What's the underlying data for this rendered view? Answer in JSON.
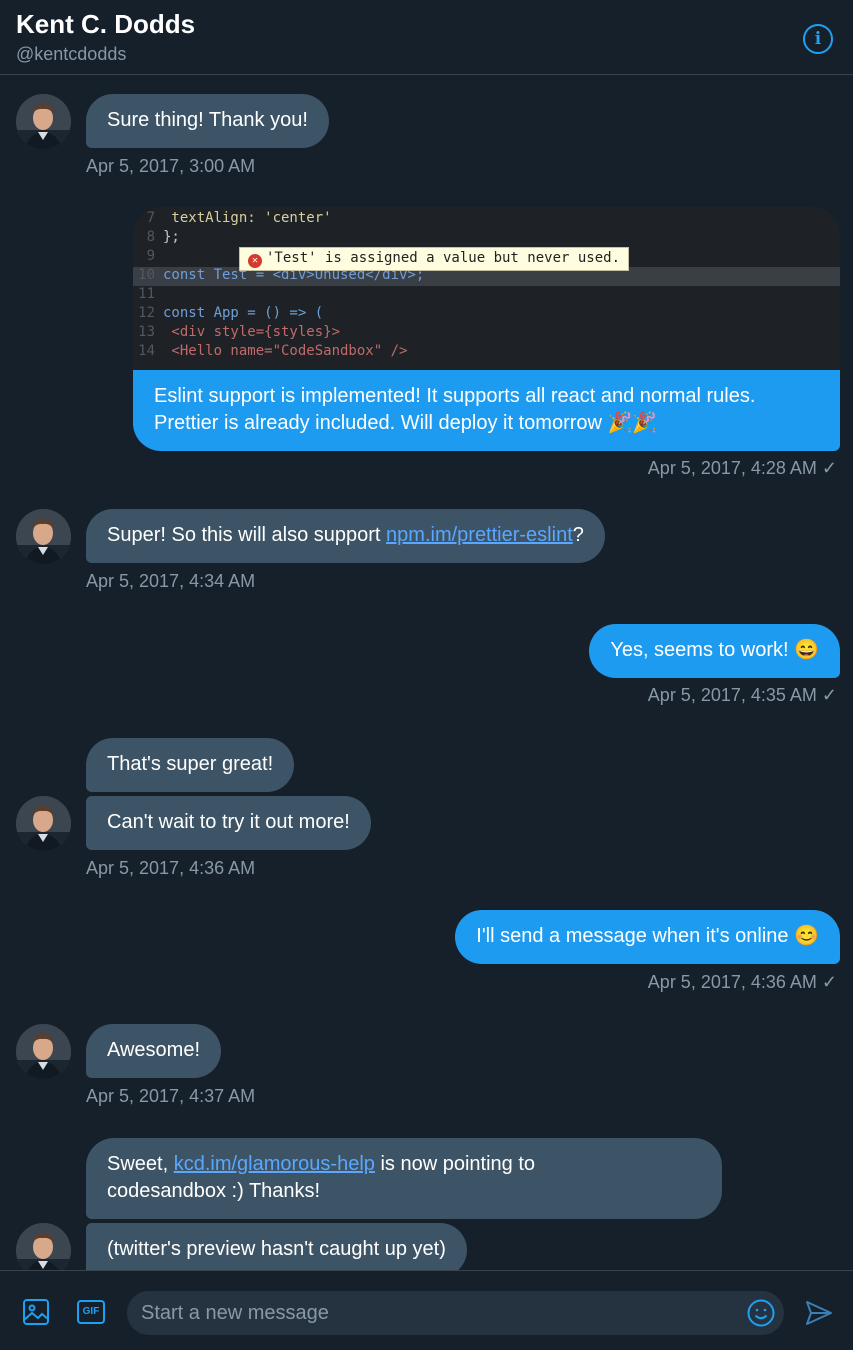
{
  "header": {
    "title": "Kent C. Dodds",
    "handle": "@kentcdodds",
    "info_icon": "info-icon"
  },
  "media": {
    "code_lines": [
      {
        "n": "7",
        "text": "  textAlign: 'center'"
      },
      {
        "n": "8",
        "text": "};"
      },
      {
        "n": "9",
        "text": ""
      },
      {
        "n": "10",
        "text": "const Test = <div>Unused</div>;"
      },
      {
        "n": "11",
        "text": ""
      },
      {
        "n": "12",
        "text": "const App = () => ("
      },
      {
        "n": "13",
        "text": "  <div style={styles}>"
      },
      {
        "n": "14",
        "text": "    <Hello name=\"CodeSandbox\" />"
      }
    ],
    "error_text": "'Test' is assigned a value but never used."
  },
  "messages": [
    {
      "text": "Sure thing! Thank you!"
    },
    {
      "time": "Apr 5, 2017, 3:00 AM"
    },
    {
      "text_line1": "Eslint support is implemented! It supports all react and normal rules.",
      "text_line2": "Prettier is already included. Will deploy it tomorrow 🎉🎉"
    },
    {
      "time": "Apr 5, 2017, 4:28 AM ✓"
    },
    {
      "text_before": "Super! So this will also support ",
      "link": "npm.im/prettier-eslint",
      "text_after": "?"
    },
    {
      "time": "Apr 5, 2017, 4:34 AM"
    },
    {
      "text": "Yes, seems to work! 😄"
    },
    {
      "time": "Apr 5, 2017, 4:35 AM ✓"
    },
    {
      "text": "That's super great!"
    },
    {
      "text": "Can't wait to try it out more!"
    },
    {
      "time": "Apr 5, 2017, 4:36 AM"
    },
    {
      "text": "I'll send a message when it's online 😊"
    },
    {
      "time": "Apr 5, 2017, 4:36 AM ✓"
    },
    {
      "text": "Awesome!"
    },
    {
      "time": "Apr 5, 2017, 4:37 AM"
    },
    {
      "text_before": "Sweet, ",
      "link": "kcd.im/glamorous-help",
      "text_after": " is now pointing to",
      "text_line2": "codesandbox :) Thanks!"
    },
    {
      "text": "(twitter's preview hasn't caught up yet)"
    }
  ],
  "composer": {
    "placeholder": "Start a new message",
    "image_icon": "image-icon",
    "gif_label": "GIF",
    "emoji_icon": "emoji-icon",
    "send_icon": "send-icon"
  },
  "colors": {
    "background": "#15202b",
    "incoming_bubble": "#3d5466",
    "outgoing_bubble": "#1d9bf0",
    "accent": "#1da1f2",
    "muted_text": "#8899a6"
  }
}
